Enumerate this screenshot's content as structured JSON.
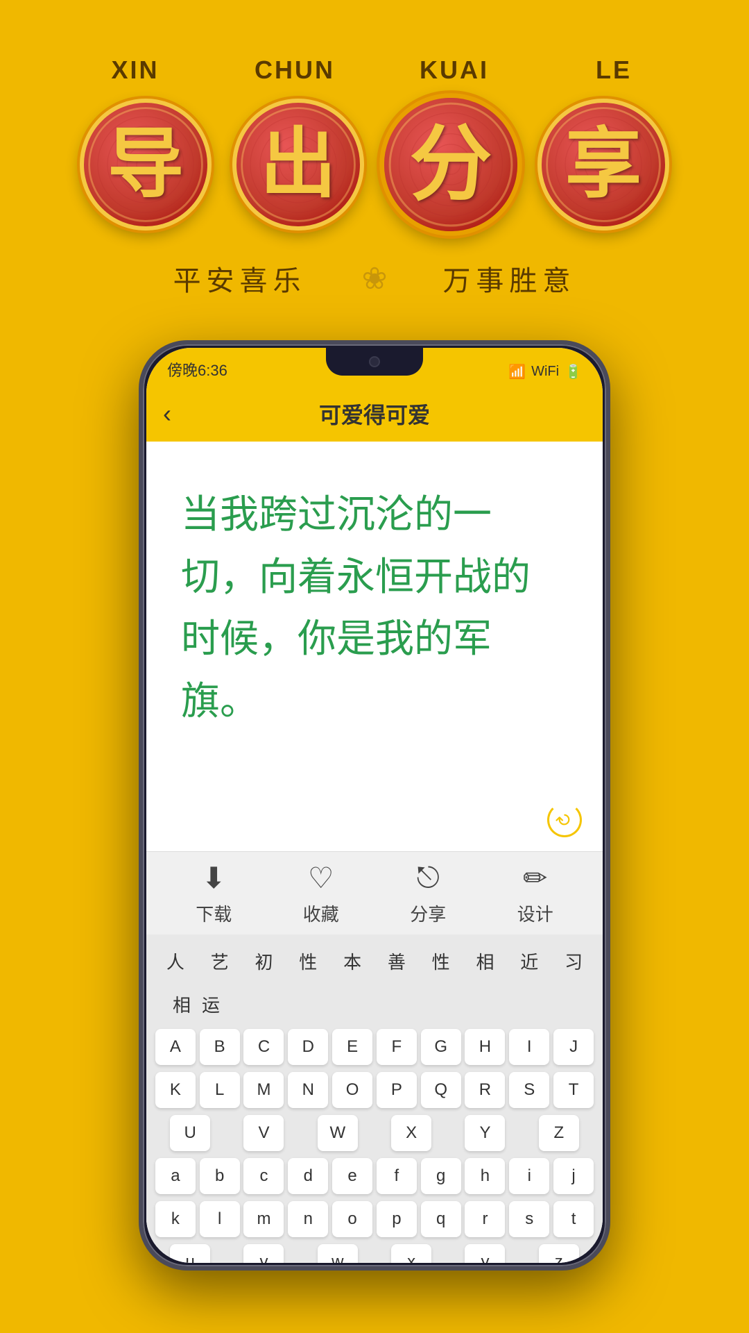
{
  "background_color": "#F0B800",
  "top": {
    "labels": [
      "XIN",
      "CHUN",
      "KUAI",
      "LE"
    ],
    "coins": [
      {
        "char": "导",
        "label": "XIN"
      },
      {
        "char": "出",
        "label": "CHUN"
      },
      {
        "char": "分",
        "label": "KUAI"
      },
      {
        "char": "享",
        "label": "LE"
      }
    ],
    "sub_left": "平安喜乐",
    "sub_right": "万事胜意",
    "lotus": "❀"
  },
  "phone": {
    "status_time": "傍晚6:36",
    "status_icons": "🔋 📶 📡",
    "header_title": "可爱得可爱",
    "back_label": "‹",
    "main_text": "当我跨过沉沦的一切，向着永恒开战的时候，你是我的军旗。",
    "actions": [
      {
        "icon": "⬇",
        "label": "下载"
      },
      {
        "icon": "♡",
        "label": "收藏"
      },
      {
        "icon": "⎋",
        "label": "分享"
      },
      {
        "icon": "✏",
        "label": "设计"
      }
    ],
    "keyboard": {
      "suggestions_row1": [
        "人",
        "艺",
        "初",
        "性",
        "本",
        "善",
        "性",
        "相",
        "近",
        "习"
      ],
      "suggestions_row2": [
        "相",
        "运"
      ],
      "letters_row1": [
        "A",
        "B",
        "C",
        "D",
        "E",
        "F",
        "G",
        "H",
        "I",
        "J"
      ],
      "letters_row2": [
        "K",
        "L",
        "M",
        "N",
        "O",
        "P",
        "Q",
        "R",
        "S",
        "T"
      ],
      "letters_row3": [
        "U",
        "V",
        "W",
        "X",
        "Y",
        "Z"
      ],
      "letters_lower1": [
        "a",
        "b",
        "c",
        "d",
        "e",
        "f",
        "g",
        "h",
        "i",
        "j"
      ],
      "letters_lower2": [
        "k",
        "l",
        "m",
        "n",
        "o",
        "p",
        "q",
        "r",
        "s",
        "t"
      ],
      "letters_lower3": [
        "u",
        "v",
        "w",
        "x",
        "y",
        "z"
      ]
    }
  }
}
